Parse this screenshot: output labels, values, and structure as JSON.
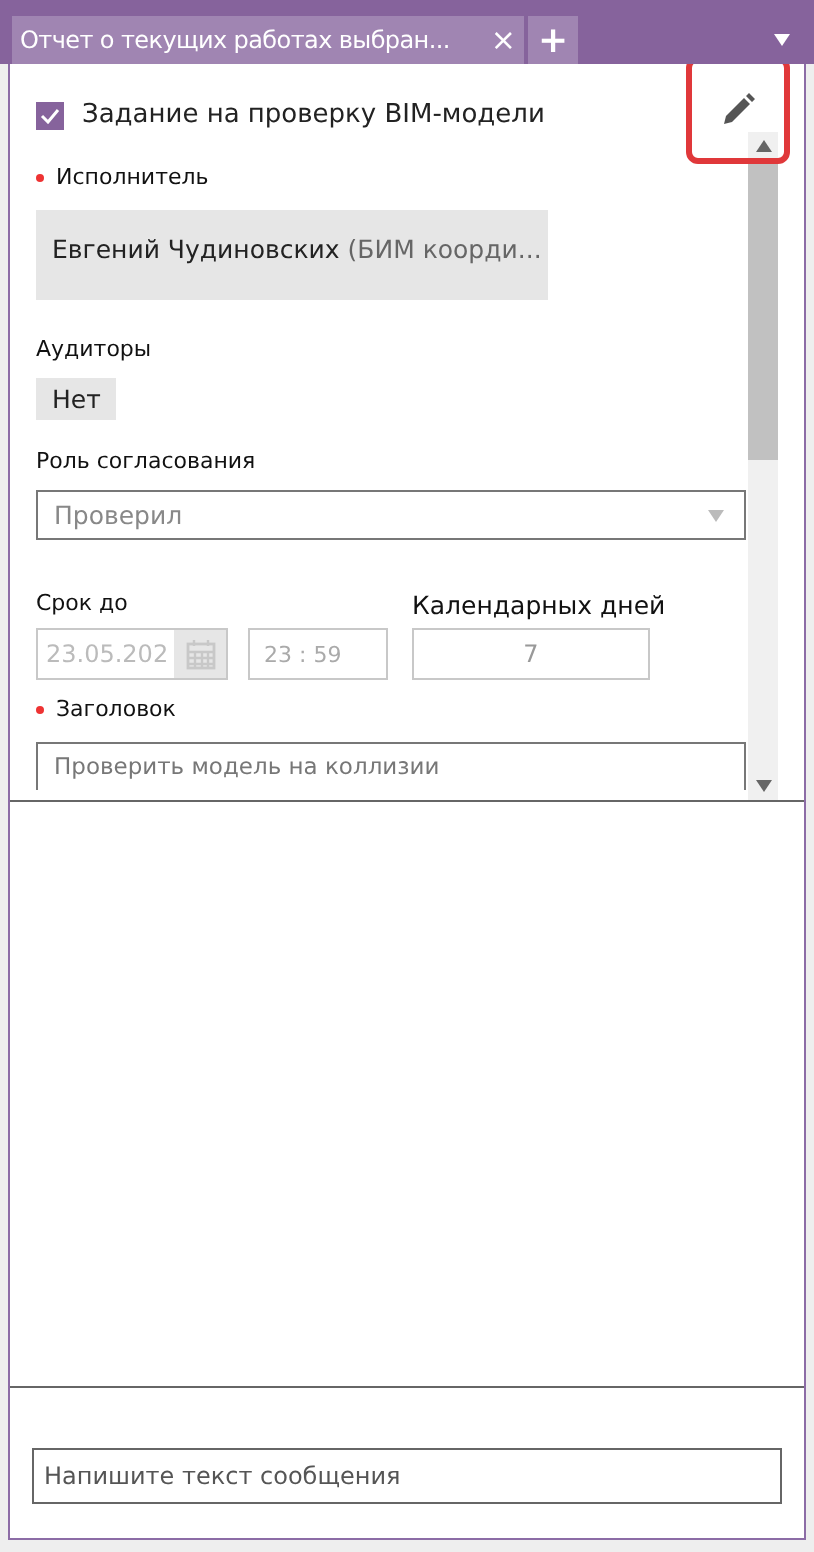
{
  "tab": {
    "title": "Отчет о текущих работах выбран...",
    "close": "×",
    "add": "+"
  },
  "task": {
    "checked": true,
    "title": "Задание на проверку BIM-модели"
  },
  "executor": {
    "label": "Исполнитель",
    "required": true,
    "name": "Евгений Чудиновских",
    "role": "(БИМ коорди..."
  },
  "auditors": {
    "label": "Аудиторы",
    "value": "Нет"
  },
  "approval_role": {
    "label": "Роль согласования",
    "value": "Проверил"
  },
  "deadline": {
    "label": "Срок до",
    "date": "23.05.202",
    "time": "23 : 59"
  },
  "calendar_days": {
    "label": "Календарных дней",
    "value": "7"
  },
  "heading": {
    "label": "Заголовок",
    "required": true,
    "value": "Проверить модель на коллизии"
  },
  "message": {
    "placeholder": "Напишите текст сообщения"
  }
}
